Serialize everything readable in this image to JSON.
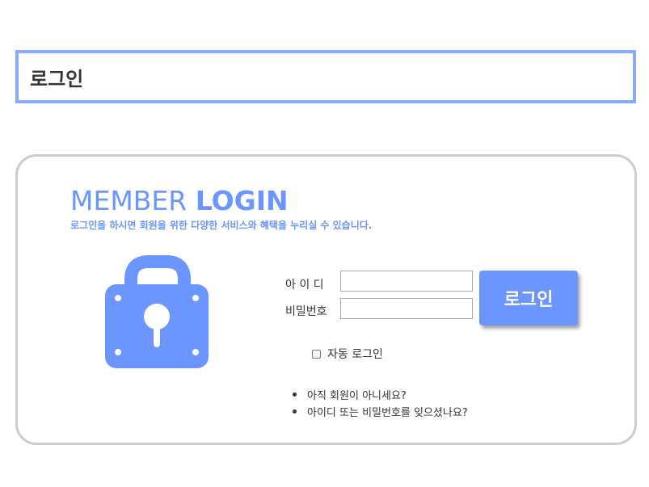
{
  "page": {
    "title": "로그인"
  },
  "login": {
    "heading_thin": "MEMBER ",
    "heading_bold": "LOGIN",
    "subheading": "로그인을 하시면 회원을 위한 다양한 서비스와 혜택을 누리실 수 있습니다.",
    "id_label": "아 이 디",
    "pw_label": "비밀번호",
    "id_value": "",
    "pw_value": "",
    "button_label": "로그인",
    "auto_login_label": "자동 로그인",
    "auto_login_checked": false,
    "links": [
      "아직 회원이 아니세요?",
      "아이디 또는 비밀번호를 잊으셨나요?"
    ],
    "lock_icon": "lock-icon"
  },
  "colors": {
    "accent": "#6b95ff",
    "title_border": "#88aaff",
    "card_border": "#cccccc"
  }
}
